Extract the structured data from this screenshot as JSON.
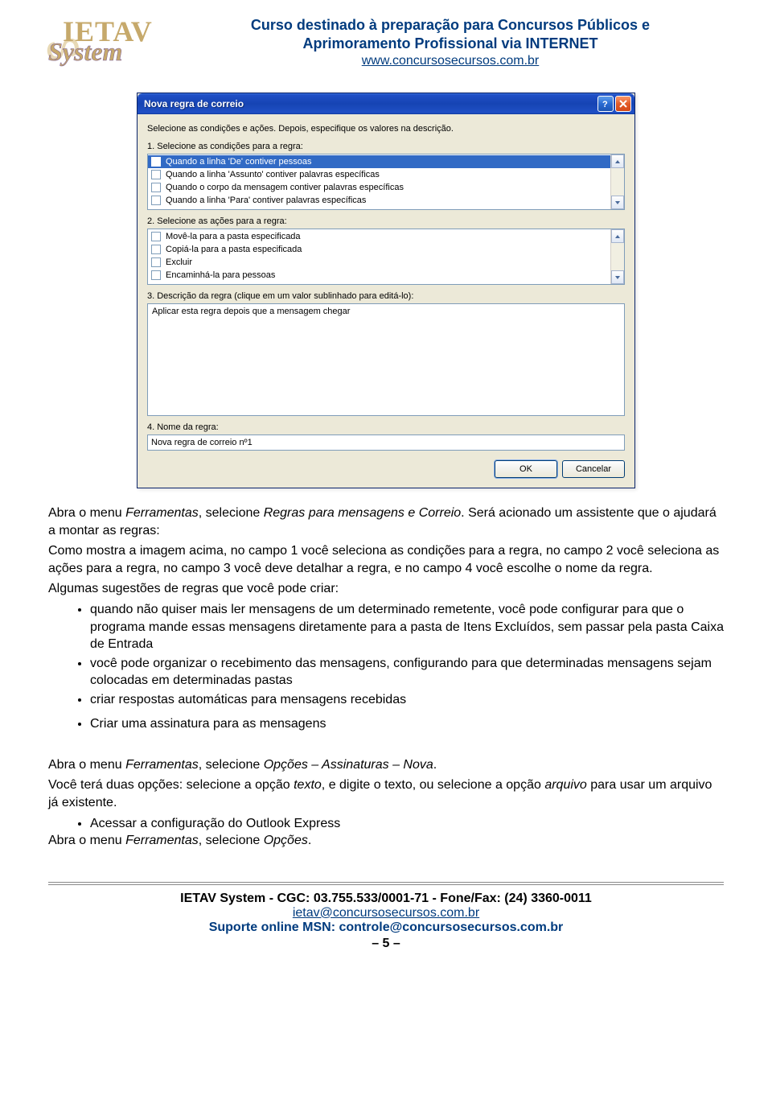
{
  "header": {
    "title_line1": "Curso destinado à preparação para Concursos Públicos e",
    "title_line2": "Aprimoramento Profissional via INTERNET",
    "url": "www.concursosecursos.com.br",
    "logo_top": "IETAV",
    "logo_bottom": "System"
  },
  "dialog": {
    "title": "Nova regra de correio",
    "instruction": "Selecione as condições e ações. Depois, especifique os valores na descrição.",
    "section1_label": "1. Selecione as condições para a regra:",
    "conditions": [
      "Quando a linha 'De' contiver pessoas",
      "Quando a linha 'Assunto' contiver palavras específicas",
      "Quando o corpo da mensagem contiver palavras específicas",
      "Quando a linha 'Para' contiver palavras específicas"
    ],
    "section2_label": "2. Selecione as ações para a regra:",
    "actions": [
      "Movê-la para a pasta especificada",
      "Copiá-la para a pasta especificada",
      "Excluir",
      "Encaminhá-la para pessoas"
    ],
    "section3_label": "3. Descrição da regra (clique em um valor sublinhado para editá-lo):",
    "description_value": "Aplicar esta regra depois que a mensagem chegar",
    "section4_label": "4. Nome da regra:",
    "name_value": "Nova regra de correio nº1",
    "ok_label": "OK",
    "cancel_label": "Cancelar"
  },
  "body": {
    "p1_a": "Abra o menu ",
    "p1_ferramentas": "Ferramentas",
    "p1_b": ", selecione ",
    "p1_regras": "Regras para mensagens e Correio",
    "p1_c": ". Será acionado um assistente que o ajudará a montar as regras:",
    "p2": "Como mostra a imagem acima, no campo 1 você seleciona as condições para a regra, no campo 2 você seleciona as ações para a regra, no campo 3 você deve detalhar a regra, e no campo 4 você escolhe o nome da regra.",
    "p3": "Algumas sugestões de regras que você pode criar:",
    "bullet1_pre": "quando não quiser mais ler mensagens de um determinado remetente, você pode configurar para que o programa mande essas mensagens diretamente para a pasta de Itens Excluídos, sem passar pela pasta Caixa de Entrada",
    "bullet2": "você pode organizar o recebimento das mensagens, configurando para que determinadas mensagens sejam colocadas em determinadas pastas",
    "bullet3": "criar respostas automáticas para mensagens recebidas",
    "bullet4": "Criar uma assinatura para as mensagens",
    "p4_a": "Abra o menu ",
    "p4_ferr": "Ferramentas",
    "p4_b": ", selecione ",
    "p4_opc": "Opções – Assinaturas – Nova",
    "p4_c": ".",
    "p5_a": "Você terá duas opções: selecione a opção ",
    "p5_texto": "texto",
    "p5_b": ", e digite o texto, ou selecione a opção ",
    "p5_arquivo": "arquivo",
    "p5_c": " para usar um arquivo já existente.",
    "bullet5": "Acessar a configuração do Outlook Express",
    "p6_a": "Abra o menu ",
    "p6_ferr": "Ferramentas",
    "p6_b": ", selecione ",
    "p6_opc": "Opções",
    "p6_c": "."
  },
  "footer": {
    "line1": "IETAV System - CGC: 03.755.533/0001-71 - Fone/Fax: (24) 3360-0011",
    "email": "ietav@concursosecursos.com.br",
    "msn_label": "Suporte online MSN: ",
    "msn_value": "controle@concursosecursos.com.br",
    "page": "– 5 –"
  }
}
